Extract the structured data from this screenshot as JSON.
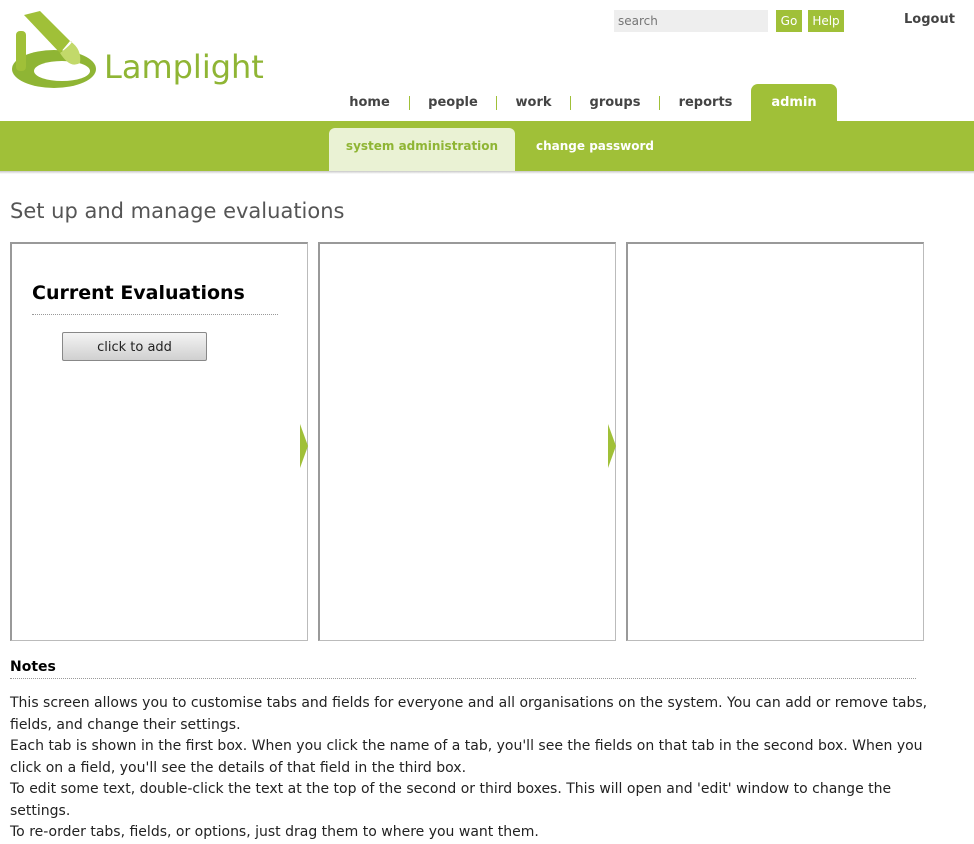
{
  "brand": {
    "name": "Lamplight",
    "color": "#a0c038"
  },
  "search": {
    "placeholder": "search",
    "go_label": "Go",
    "help_label": "Help"
  },
  "header": {
    "logout_label": "Logout"
  },
  "nav": {
    "items": [
      {
        "label": "home"
      },
      {
        "label": "people"
      },
      {
        "label": "work"
      },
      {
        "label": "groups"
      },
      {
        "label": "reports"
      },
      {
        "label": "admin",
        "active": true
      }
    ]
  },
  "subnav": {
    "items": [
      {
        "label": "system administration",
        "active": true
      },
      {
        "label": "change password"
      }
    ]
  },
  "page": {
    "title": "Set up and manage evaluations"
  },
  "panels": {
    "first": {
      "heading": "Current Evaluations",
      "add_button": "click to add"
    }
  },
  "notes": {
    "title": "Notes",
    "paragraphs": [
      "This screen allows you to customise tabs and fields for everyone and all organisations on the system. You can add or remove tabs, fields, and change their settings.",
      "Each tab is shown in the first box. When you click the name of a tab, you'll see the fields on that tab in the second box. When you click on a field, you'll see the details of that field in the third box.",
      "To edit some text, double-click the text at the top of the second or third boxes. This will open and 'edit' window to change the settings.",
      "To re-order tabs, fields, or options, just drag them to where you want them."
    ]
  }
}
